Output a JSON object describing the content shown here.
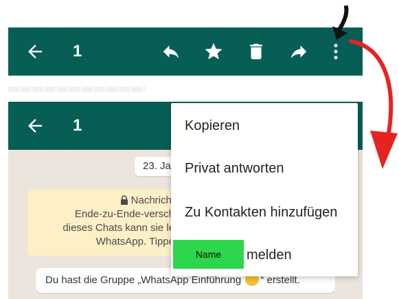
{
  "toolbar_top": {
    "back_icon": "arrow-left-icon",
    "count": "1",
    "actions": [
      {
        "icon": "reply-icon"
      },
      {
        "icon": "star-icon"
      },
      {
        "icon": "trash-icon"
      },
      {
        "icon": "forward-icon"
      },
      {
        "icon": "more-vertical-icon"
      }
    ]
  },
  "toolbar_bottom": {
    "back_icon": "arrow-left-icon",
    "count": "1"
  },
  "chat": {
    "date": "23. Ja",
    "encryption_lines": [
      "Nachricht",
      "Ende-zu-Ende-versch",
      "dieses Chats kann sie le",
      "WhatsApp. Tippe"
    ],
    "system_message_before": "Du hast die Gruppe „WhatsApp Einführung ",
    "system_message_after": "“ erstellt."
  },
  "menu": {
    "items": [
      "Kopieren",
      "Privat antworten",
      "Zu Kontakten hinzufügen"
    ],
    "last_item_suffix": "melden",
    "name_overlay": "Name"
  },
  "colors": {
    "toolbar": "#075e54",
    "chat_background": "#ece5dd",
    "encryption_box": "#fdefc6",
    "name_overlay": "#2dd64b",
    "annotation_arrow": "#e52421"
  }
}
